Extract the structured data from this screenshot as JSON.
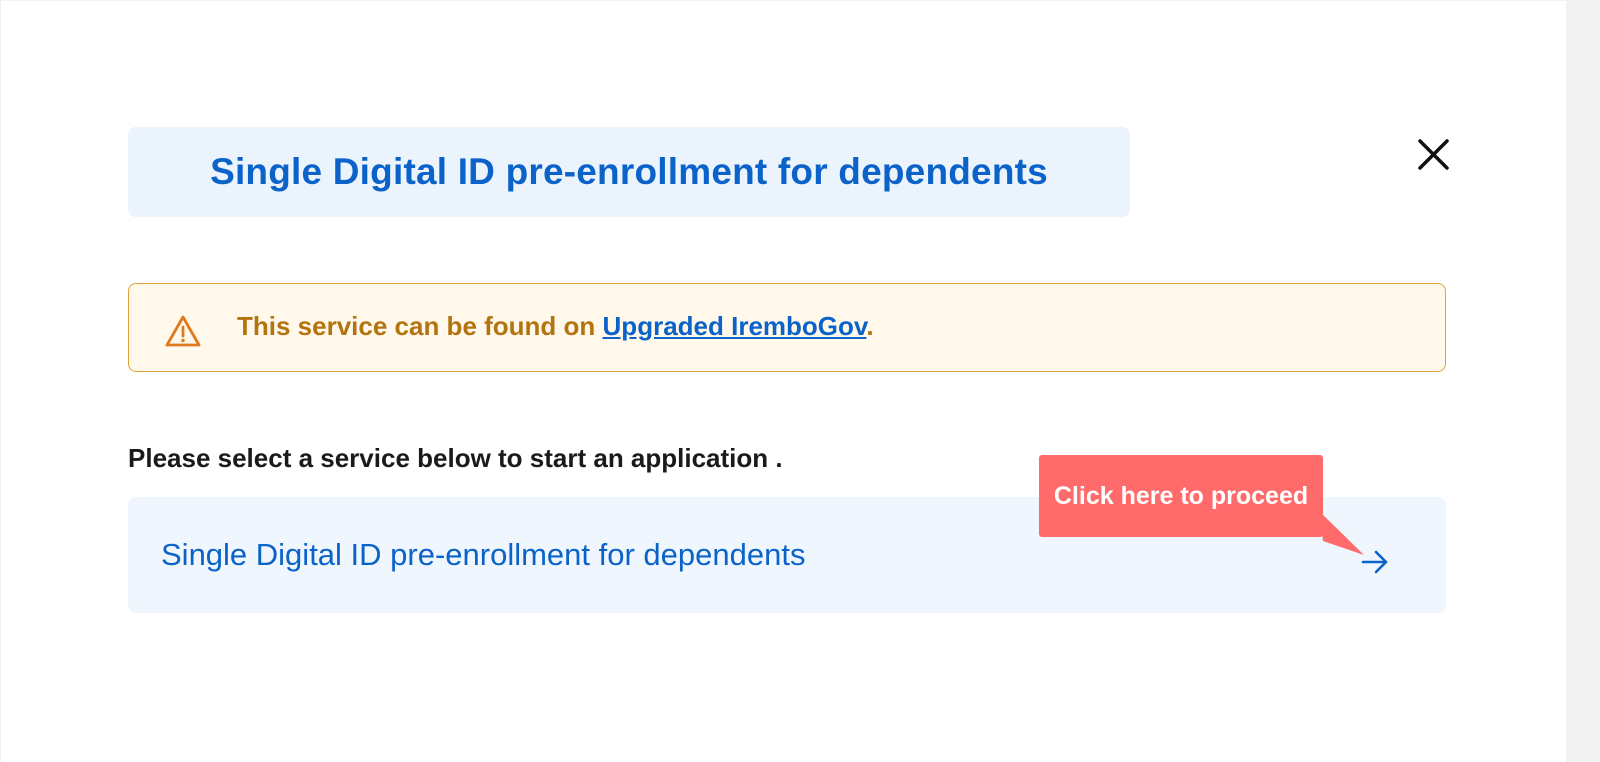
{
  "modal": {
    "title": "Single Digital ID pre-enrollment for dependents",
    "close_icon": "close-icon"
  },
  "alert": {
    "icon": "warning-icon",
    "text_prefix": "This service can be found on ",
    "link_text": "Upgraded IremboGov",
    "text_suffix": ".",
    "colors": {
      "text": "#b37410",
      "border": "#e0a33a",
      "background": "#fff8eb",
      "icon": "#e07a1f"
    }
  },
  "prompt": {
    "text": "Please select a service below to start an application ."
  },
  "services": [
    {
      "label": "Single Digital ID pre-enrollment for dependents",
      "icon": "arrow-right-icon"
    }
  ],
  "tooltip": {
    "text": "Click here to proceed",
    "color": "#ff6a6a"
  },
  "colors": {
    "accent": "#0b63c9",
    "title_bg": "#ebf3fd",
    "service_bg": "#eff6fe"
  }
}
